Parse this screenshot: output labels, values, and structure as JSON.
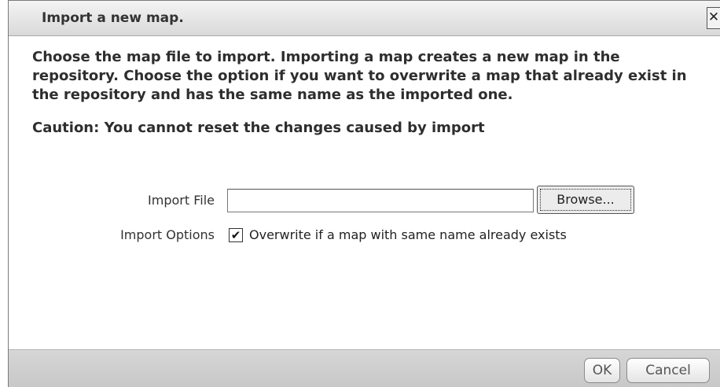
{
  "dialog": {
    "title": "Import a new map.",
    "close_label": "✕",
    "description": "Choose the map file to import. Importing a map creates a new map in the repository. Choose the option if you want to overwrite a map that already exist in the repository and has the same name as the imported one.",
    "caution": "Caution: You cannot reset the changes caused by import"
  },
  "form": {
    "import_file_label": "Import File",
    "import_file_value": "",
    "browse_label": "Browse...",
    "import_options_label": "Import Options",
    "overwrite_checked": true,
    "overwrite_check_mark": "✔",
    "overwrite_label": "Overwrite if a map with same name already exists"
  },
  "footer": {
    "ok_label": "OK",
    "cancel_label": "Cancel"
  }
}
